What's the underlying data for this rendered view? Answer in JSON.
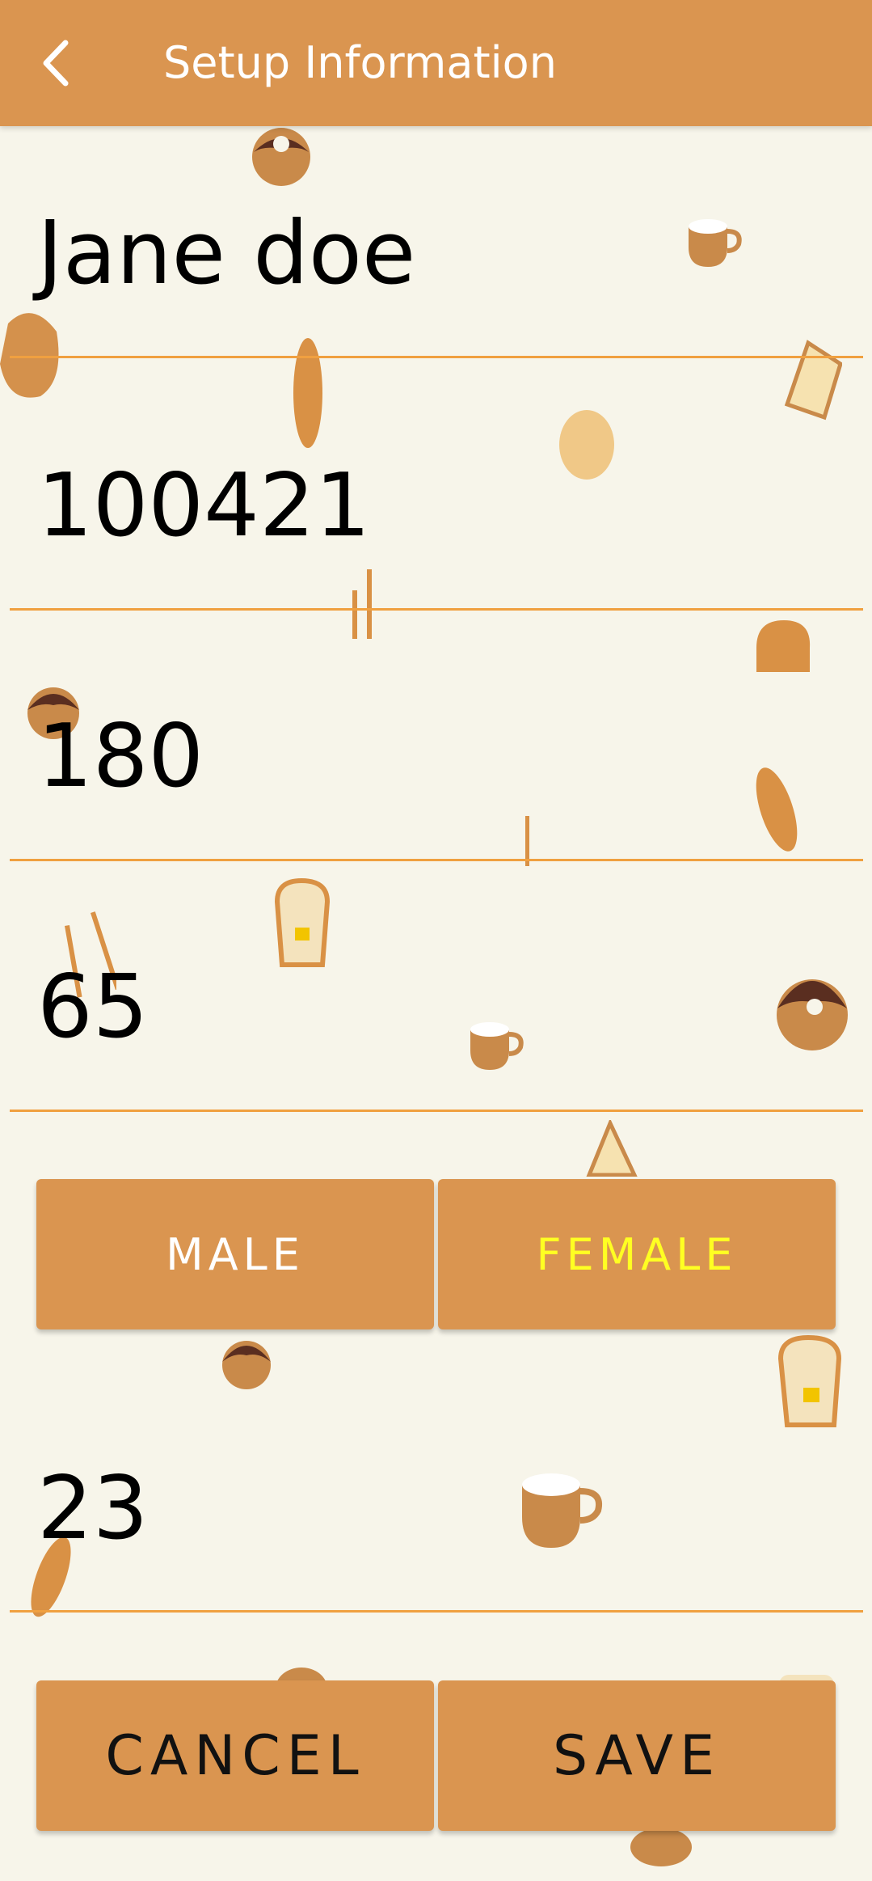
{
  "header": {
    "title": "Setup Information",
    "back_icon": "chevron-left-icon"
  },
  "form": {
    "name": "Jane doe",
    "id_number": "100421",
    "height": "180",
    "weight": "65",
    "age": "23"
  },
  "gender": {
    "male_label": "MALE",
    "female_label": "FEMALE",
    "selected": "FEMALE"
  },
  "actions": {
    "cancel_label": "CANCEL",
    "save_label": "SAVE"
  },
  "colors": {
    "appbar": "#da9550",
    "background": "#f7f5ea",
    "divider": "#f0a040",
    "selected_text": "#ffff22"
  }
}
